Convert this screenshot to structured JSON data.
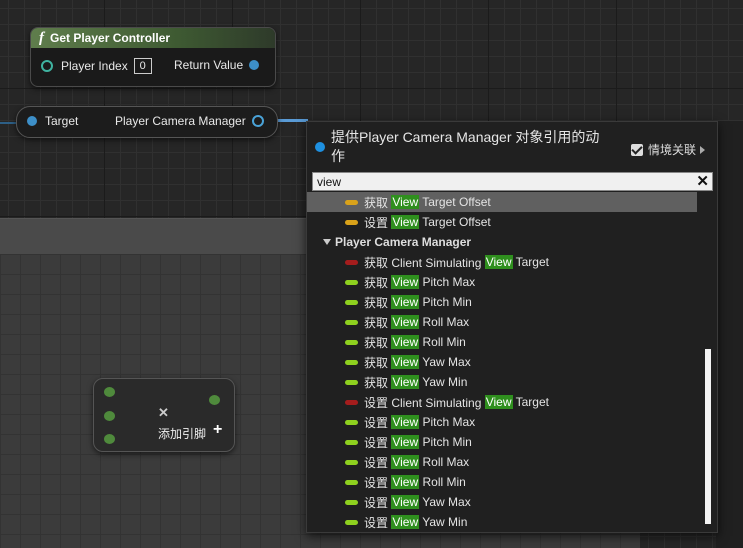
{
  "graph": {
    "get_player_controller": {
      "fn_symbol": "f",
      "title": "Get Player Controller",
      "input_pin_label": "Player Index",
      "input_pin_value": "0",
      "output_pin_label": "Return Value"
    },
    "camera_manager_node": {
      "target_label": "Target",
      "output_label": "Player Camera Manager"
    },
    "add_pin_node": {
      "close_symbol": "✕",
      "add_pin_label": "添加引脚",
      "add_symbol": "+"
    }
  },
  "menu": {
    "title": "提供Player Camera Manager 对象引用的动作",
    "context_sensitive_label": "情境关联",
    "context_sensitive_checked": true,
    "search_value": "view",
    "clear_symbol": "✕",
    "items": [
      {
        "prefix": "获取 ",
        "highlight": "View",
        "suffix": " Target Offset",
        "pill_color": "#d9a21a",
        "selected": true
      },
      {
        "prefix": "设置 ",
        "highlight": "View",
        "suffix": " Target Offset",
        "pill_color": "#d9a21a"
      },
      {
        "category": "Player Camera Manager"
      },
      {
        "prefix": "获取 Client Simulating ",
        "highlight": "View",
        "suffix": " Target",
        "pill_color": "#a51d1d"
      },
      {
        "prefix": "获取 ",
        "highlight": "View",
        "suffix": " Pitch Max",
        "pill_color": "#8fd11f"
      },
      {
        "prefix": "获取 ",
        "highlight": "View",
        "suffix": " Pitch Min",
        "pill_color": "#8fd11f"
      },
      {
        "prefix": "获取 ",
        "highlight": "View",
        "suffix": " Roll Max",
        "pill_color": "#8fd11f"
      },
      {
        "prefix": "获取 ",
        "highlight": "View",
        "suffix": " Roll Min",
        "pill_color": "#8fd11f"
      },
      {
        "prefix": "获取 ",
        "highlight": "View",
        "suffix": " Yaw Max",
        "pill_color": "#8fd11f"
      },
      {
        "prefix": "获取 ",
        "highlight": "View",
        "suffix": " Yaw Min",
        "pill_color": "#8fd11f"
      },
      {
        "prefix": "设置 Client Simulating ",
        "highlight": "View",
        "suffix": " Target",
        "pill_color": "#a51d1d"
      },
      {
        "prefix": "设置 ",
        "highlight": "View",
        "suffix": " Pitch Max",
        "pill_color": "#8fd11f"
      },
      {
        "prefix": "设置 ",
        "highlight": "View",
        "suffix": " Pitch Min",
        "pill_color": "#8fd11f"
      },
      {
        "prefix": "设置 ",
        "highlight": "View",
        "suffix": " Roll Max",
        "pill_color": "#8fd11f"
      },
      {
        "prefix": "设置 ",
        "highlight": "View",
        "suffix": " Roll Min",
        "pill_color": "#8fd11f"
      },
      {
        "prefix": "设置 ",
        "highlight": "View",
        "suffix": " Yaw Max",
        "pill_color": "#8fd11f"
      },
      {
        "prefix": "设置 ",
        "highlight": "View",
        "suffix": " Yaw Min",
        "pill_color": "#8fd11f"
      }
    ]
  }
}
